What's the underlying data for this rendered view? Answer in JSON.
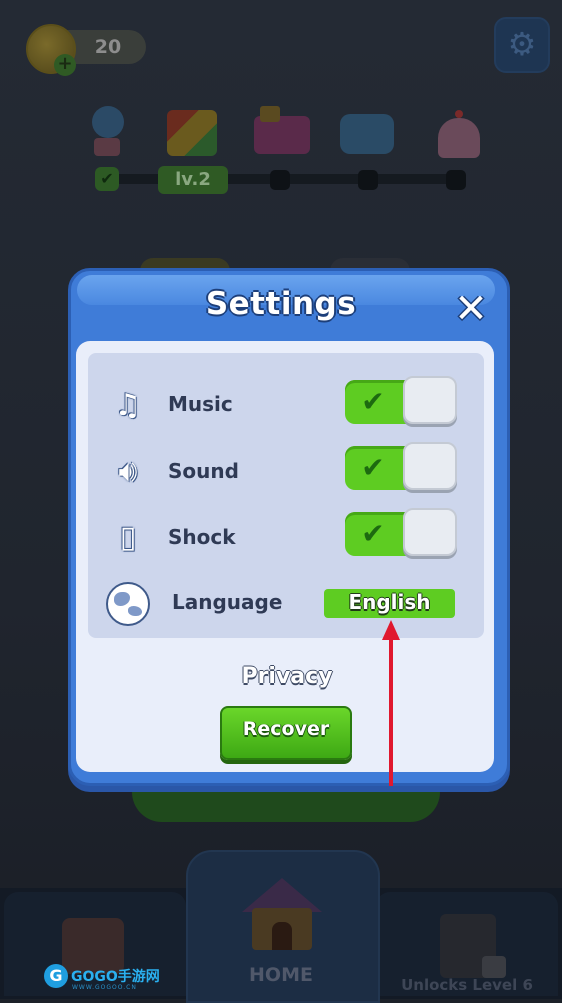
{
  "hud": {
    "coin_count": "20",
    "coin_icon": "coin-icon",
    "add_icon": "plus-icon",
    "settings_icon": "gear-icon"
  },
  "progress": {
    "level_label": "lv.2",
    "items": [
      "tree-icon",
      "rubiks-cube-icon",
      "toy-train-icon",
      "sofa-icon",
      "cupcake-icon"
    ]
  },
  "settings": {
    "title": "Settings",
    "close_icon": "close-icon",
    "rows": [
      {
        "label": "Music",
        "icon": "music-note-icon",
        "enabled": true
      },
      {
        "label": "Sound",
        "icon": "speaker-icon",
        "enabled": true
      },
      {
        "label": "Shock",
        "icon": "vibration-icon",
        "enabled": true
      }
    ],
    "language": {
      "label": "Language",
      "icon": "globe-icon",
      "value": "English"
    },
    "privacy_label": "Privacy",
    "recover_label": "Recover"
  },
  "bottom_nav": {
    "home_label": "HOME",
    "unlock_label": "Unlocks Level 6"
  },
  "watermark": {
    "text": "GOGO手游网",
    "sub": "WWW.GOGOO.CN"
  },
  "colors": {
    "modal_blue": "#3f7cd8",
    "toggle_green": "#5ecc22",
    "arrow_red": "#e0182e"
  }
}
